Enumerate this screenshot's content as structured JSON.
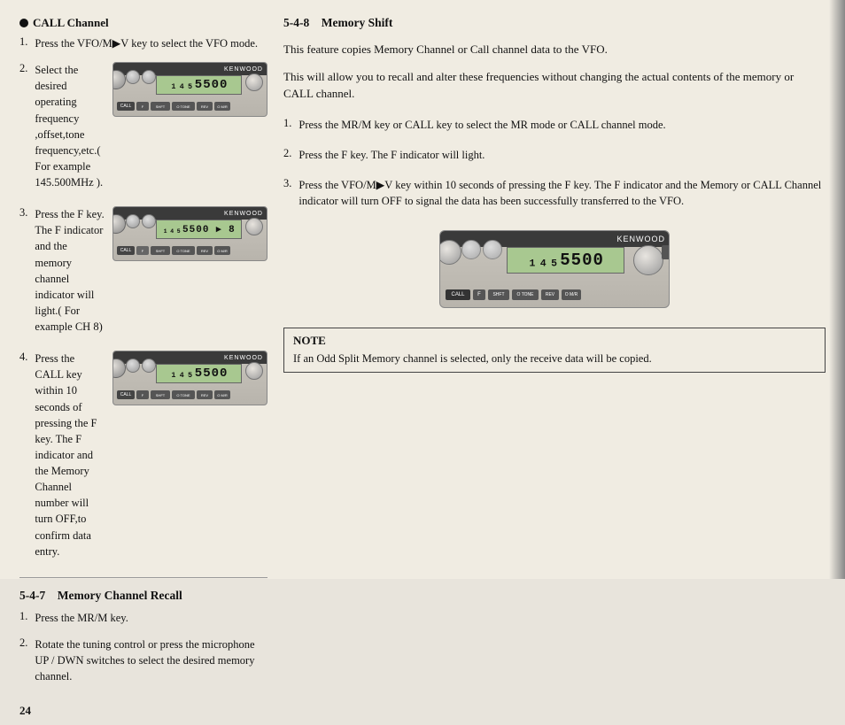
{
  "left": {
    "call_section": {
      "title": "CALL Channel",
      "steps": [
        {
          "number": "1.",
          "text": "Press the VFO/M▶V key to select the VFO mode."
        },
        {
          "number": "2.",
          "text": "Select the desired operating frequency ,offset,tone frequency,etc.( For example 145.500MHz )."
        },
        {
          "number": "3.",
          "text": "Press the F key. The F indicator and the memory channel indicator will light.( For example CH 8)"
        },
        {
          "number": "4.",
          "text": "Press the CALL key within 10 seconds of pressing the F key. The F indicator and the Memory Channel number will turn OFF,to confirm data entry."
        }
      ],
      "freq": "₁₄₅.500",
      "freq2": "₁₄₅.500 ▸ 8",
      "freq3": "₁₄₅.500"
    },
    "recall_section": {
      "header": "5-4-7",
      "title": "Memory Channel Recall",
      "steps": [
        {
          "number": "1.",
          "text": "Press the MR/M key."
        },
        {
          "number": "2.",
          "text": "Rotate the tuning control or press the microphone UP / DWN switches to select the desired memory channel."
        }
      ]
    }
  },
  "right": {
    "header": "5-4-8",
    "title": "Memory Shift",
    "intro1": "This feature copies Memory Channel or Call channel data to the VFO.",
    "intro2": "This will allow you to recall and alter these frequencies without changing the actual contents of the memory or CALL channel.",
    "steps": [
      {
        "number": "1.",
        "text": "Press the MR/M key or CALL key to select the MR mode or CALL channel mode."
      },
      {
        "number": "2.",
        "text": "Press the F key. The F indicator will light."
      },
      {
        "number": "3.",
        "text": "Press the VFO/M▶V key within 10 seconds of pressing the F key. The F indicator and the Memory or CALL Channel indicator will turn OFF to signal the data has been successfully transferred to the VFO."
      }
    ],
    "freq_display": "₁₄₅.500",
    "note": {
      "title": "NOTE",
      "text": "If an Odd Split Memory channel is selected, only the receive data will be copied."
    }
  },
  "page_number": "24",
  "brand": "KENWOOD",
  "call_btn_label": "CALL",
  "select_text": "Select the"
}
